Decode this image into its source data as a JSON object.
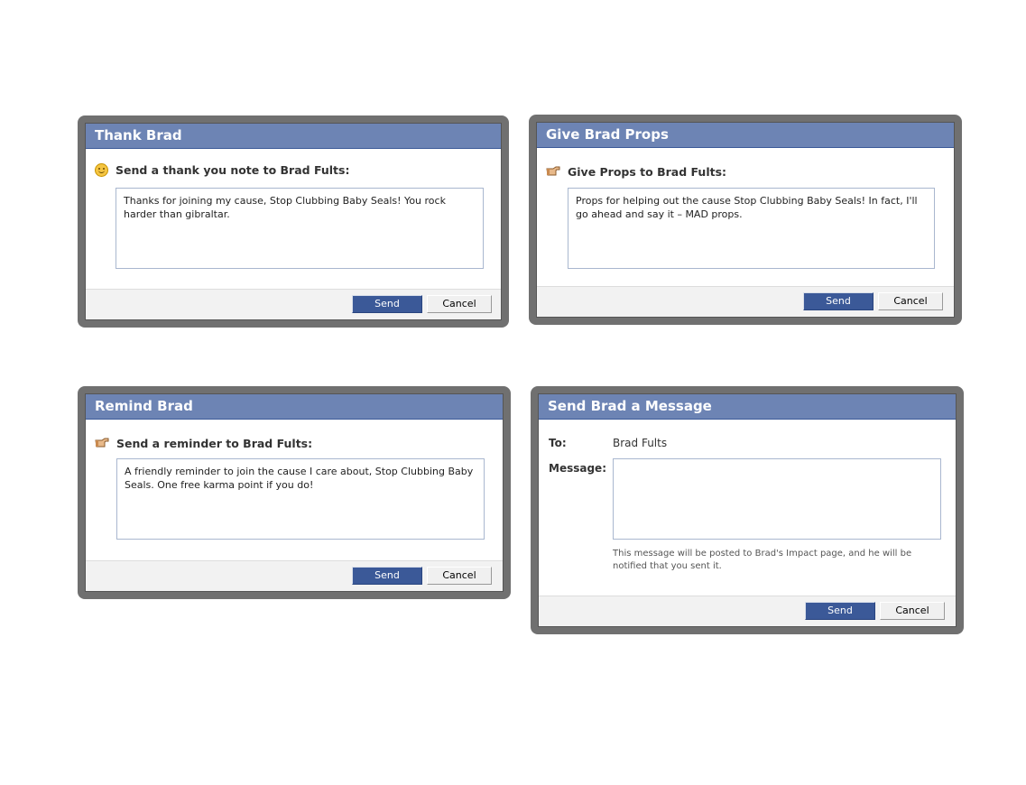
{
  "thank": {
    "title": "Thank Brad",
    "prompt": "Send a thank you note to Brad Fults:",
    "icon": "smiley-icon",
    "message": "Thanks for joining my cause, Stop Clubbing Baby Seals! You rock harder than gibraltar.",
    "send_label": "Send",
    "cancel_label": "Cancel"
  },
  "props": {
    "title": "Give Brad Props",
    "prompt": "Give Props to Brad Fults:",
    "icon": "pointing-hand-icon",
    "message": "Props for helping out the cause Stop Clubbing Baby Seals! In fact, I'll go ahead and say it – MAD props.",
    "send_label": "Send",
    "cancel_label": "Cancel"
  },
  "remind": {
    "title": "Remind Brad",
    "prompt": "Send a reminder to Brad Fults:",
    "icon": "pointing-hand-icon",
    "message": "A friendly reminder to join the cause I care about, Stop Clubbing Baby Seals. One free karma point if you do!",
    "send_label": "Send",
    "cancel_label": "Cancel"
  },
  "message": {
    "title": "Send Brad a Message",
    "to_label": "To:",
    "to_value": "Brad Fults",
    "message_label": "Message:",
    "message_value": "",
    "note": "This message will be posted to Brad's Impact page, and he will be notified that you sent it.",
    "send_label": "Send",
    "cancel_label": "Cancel"
  },
  "colors": {
    "title_bar": "#6d84b4",
    "send_button": "#3b5998",
    "frame": "#707070"
  }
}
